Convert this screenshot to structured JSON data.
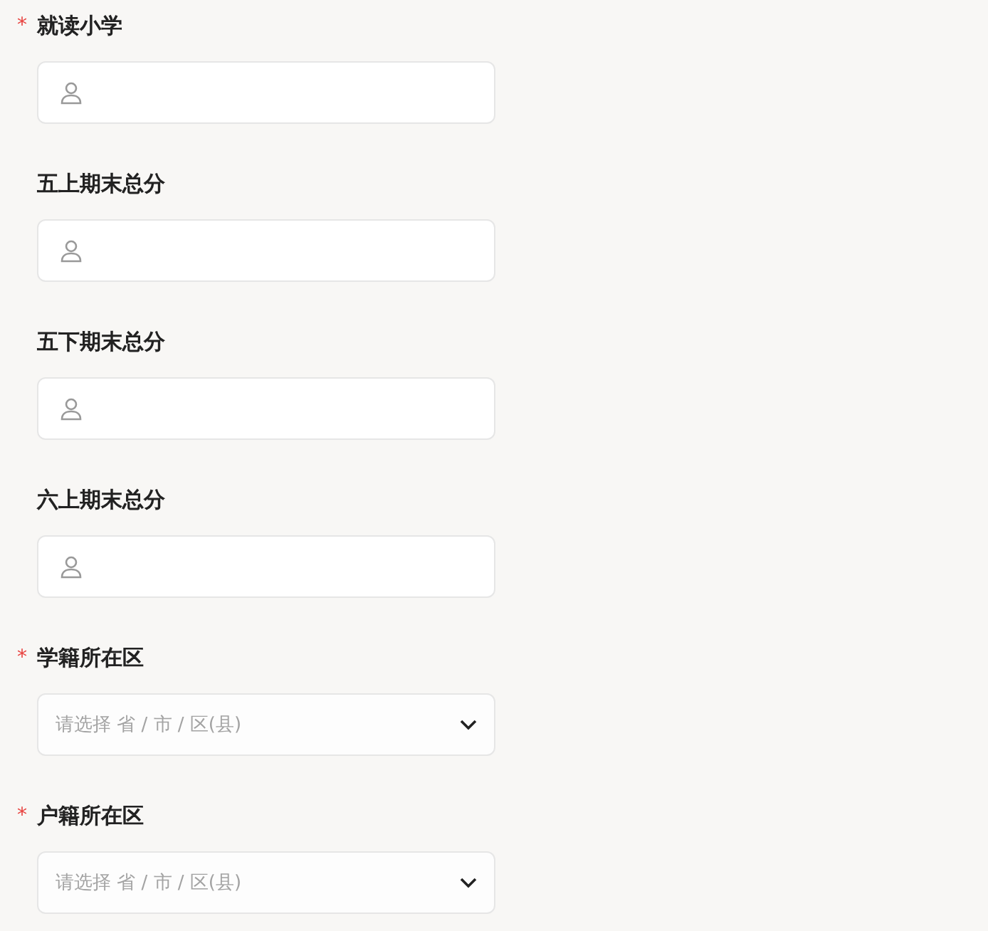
{
  "fields": [
    {
      "kind": "text",
      "label": "就读小学",
      "marker": "*"
    },
    {
      "kind": "text",
      "label": "五上期末总分"
    },
    {
      "kind": "text",
      "label": "五下期末总分"
    },
    {
      "kind": "text",
      "label": "六上期末总分"
    },
    {
      "kind": "select",
      "label": "学籍所在区",
      "marker": "*",
      "placeholder": "请选择 省 / 市 / 区(县)"
    },
    {
      "kind": "select",
      "label": "户籍所在区",
      "marker": "*",
      "placeholder": "请选择 省 / 市 / 区(县)"
    }
  ]
}
